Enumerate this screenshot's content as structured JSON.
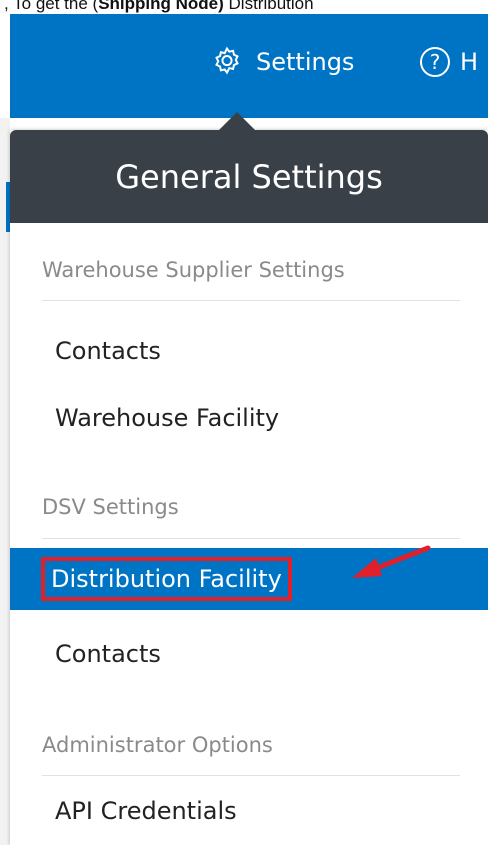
{
  "caption": {
    "prefix": ", To get the (",
    "bold": "Shipping Node)",
    "suffix": " Distribution"
  },
  "topbar": {
    "settings_label": "Settings",
    "help_glyph": "?",
    "help_label_partial": "H",
    "background": "#0074c4"
  },
  "dropdown": {
    "header": "General Settings",
    "sections": [
      {
        "title": "Warehouse Supplier Settings",
        "items": [
          "Contacts",
          "Warehouse Facility"
        ]
      },
      {
        "title": "DSV Settings",
        "items": [
          "Distribution Facility",
          "Contacts"
        ]
      },
      {
        "title": "Administrator Options",
        "items": [
          "API Credentials"
        ]
      }
    ],
    "active_item": "Distribution Facility",
    "header_bg": "#3a4047",
    "highlight_color": "#e0202a"
  },
  "icons": {
    "settings": "gear-icon",
    "help": "help-circle-icon",
    "annotation": "red-arrow-icon"
  }
}
